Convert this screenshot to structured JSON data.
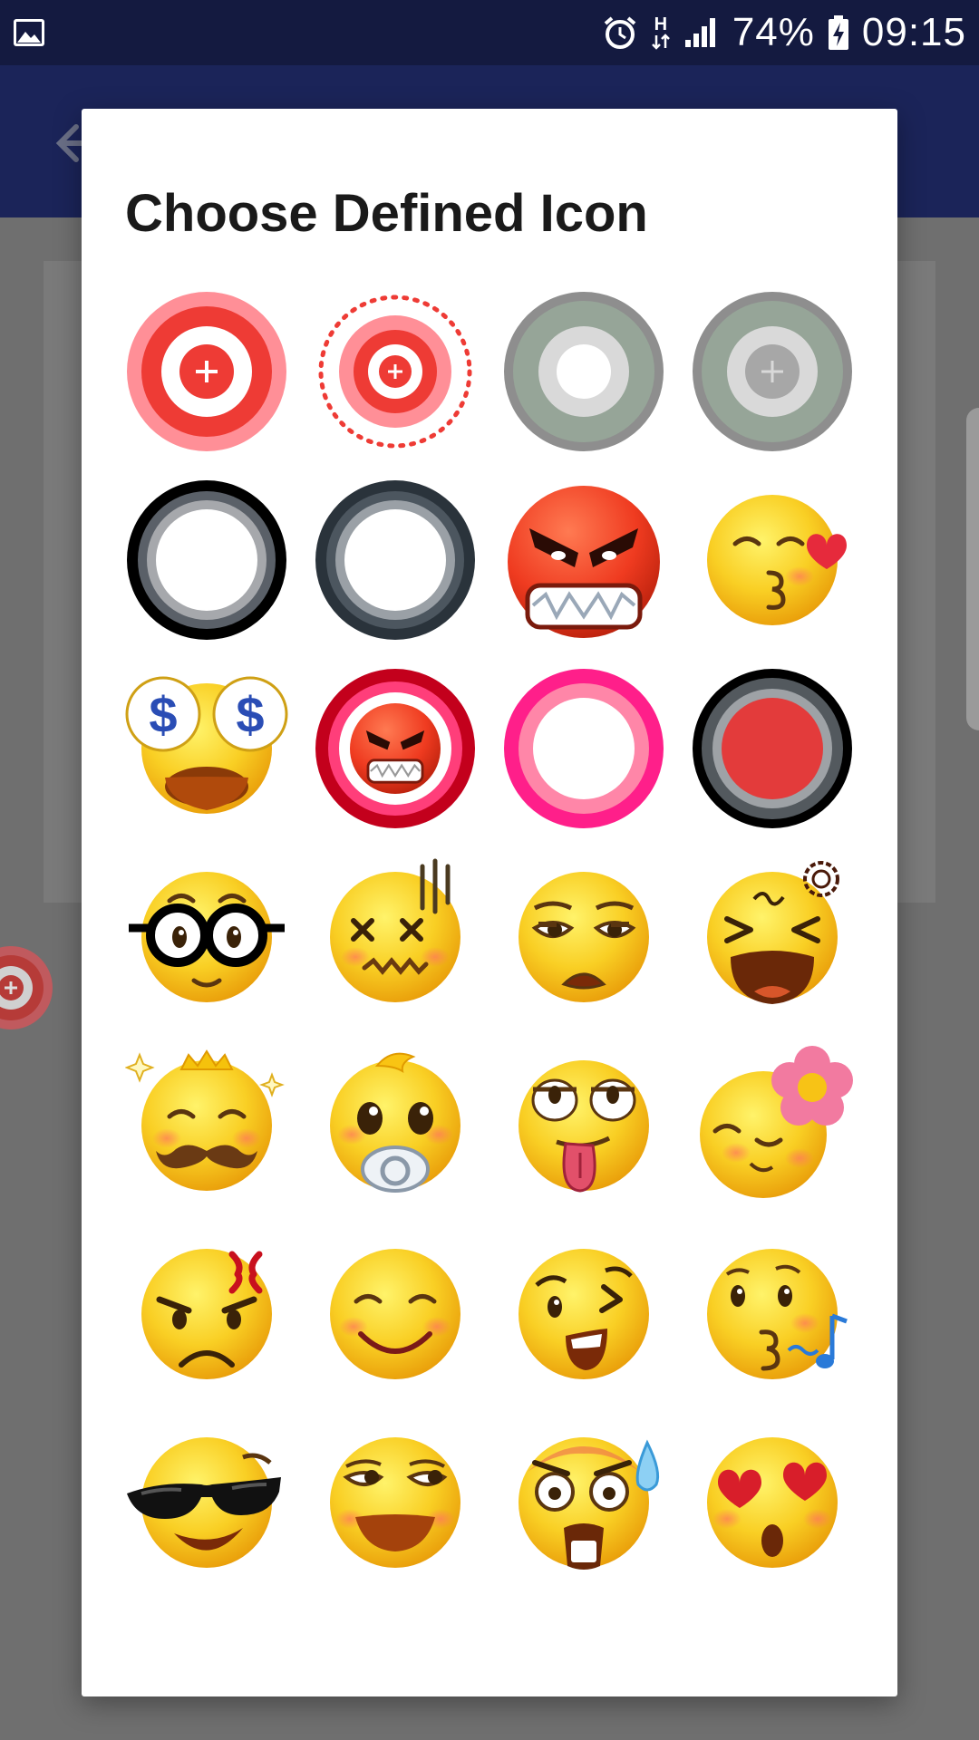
{
  "status_bar": {
    "network_type": "H",
    "battery": "74%",
    "time": "09:15",
    "icons": [
      "gallery-icon",
      "alarm-icon",
      "data-arrows-icon",
      "signal-icon",
      "battery-charging-icon"
    ]
  },
  "dialog": {
    "title": "Choose Defined Icon",
    "icons": [
      {
        "name": "red-target-plus-icon"
      },
      {
        "name": "red-target-dotted-ring-icon"
      },
      {
        "name": "gray-ring-icon"
      },
      {
        "name": "gray-ring-plus-icon"
      },
      {
        "name": "black-ring-icon"
      },
      {
        "name": "dark-slate-ring-icon"
      },
      {
        "name": "angry-face-emoji-icon"
      },
      {
        "name": "kissing-heart-emoji-icon"
      },
      {
        "name": "money-eyes-emoji-icon"
      },
      {
        "name": "red-ring-angry-face-icon"
      },
      {
        "name": "pink-ring-icon"
      },
      {
        "name": "black-ring-red-center-icon"
      },
      {
        "name": "nerd-glasses-emoji-icon"
      },
      {
        "name": "dizzy-face-emoji-icon"
      },
      {
        "name": "tired-face-emoji-icon"
      },
      {
        "name": "frustrated-yell-emoji-icon"
      },
      {
        "name": "crowned-mustache-emoji-icon"
      },
      {
        "name": "baby-pacifier-emoji-icon"
      },
      {
        "name": "tongue-out-emoji-icon"
      },
      {
        "name": "flower-emoji-icon"
      },
      {
        "name": "angry-vein-emoji-icon"
      },
      {
        "name": "happy-closed-eyes-emoji-icon"
      },
      {
        "name": "winking-emoji-icon"
      },
      {
        "name": "whistling-emoji-icon"
      },
      {
        "name": "sunglasses-emoji-icon"
      },
      {
        "name": "smirking-emoji-icon"
      },
      {
        "name": "shocked-sweat-emoji-icon"
      },
      {
        "name": "heart-eyes-emoji-icon"
      }
    ]
  },
  "colors": {
    "status_bar": "#141a40",
    "app_bar": "#1b2459",
    "scrim": "#6f6f6f",
    "dialog_bg": "#ffffff",
    "emoji_yellow": "#f7c623",
    "target_red": "#ee3b35",
    "target_pink": "#ff8f97"
  }
}
